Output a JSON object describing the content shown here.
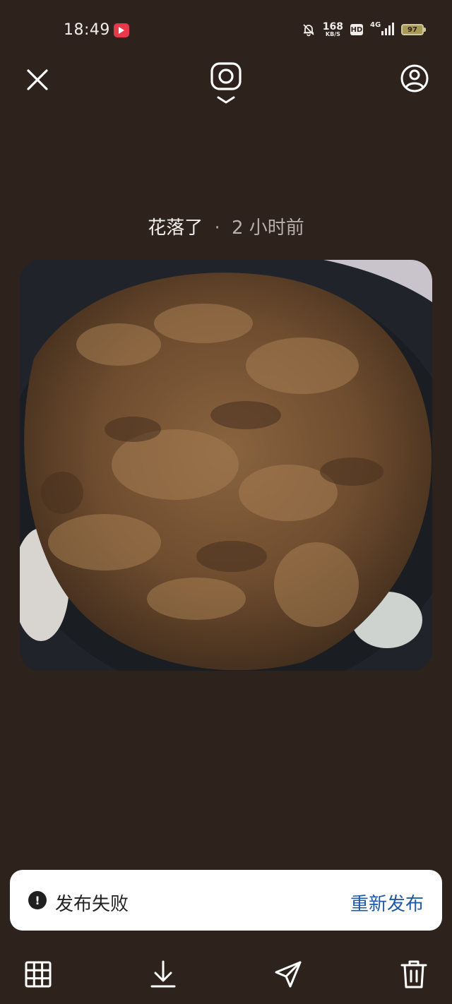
{
  "status_bar": {
    "time": "18:49",
    "network_speed_value": "168",
    "network_speed_unit": "KB/S",
    "hd_label": "HD",
    "network_type": "4G",
    "battery_level": "97"
  },
  "top_bar": {
    "close_icon": "close-icon",
    "camera_icon": "camera-icon",
    "profile_icon": "profile-icon"
  },
  "post": {
    "author": "花落了",
    "separator": "·",
    "time_ago": "2 小时前"
  },
  "toast": {
    "icon": "exclamation",
    "message": "发布失败",
    "action": "重新发布"
  },
  "bottom_bar": {
    "icons": [
      "grid-icon",
      "download-icon",
      "send-icon",
      "trash-icon"
    ]
  },
  "colors": {
    "background": "#2d221c",
    "toast_action": "#1f5aa7"
  }
}
